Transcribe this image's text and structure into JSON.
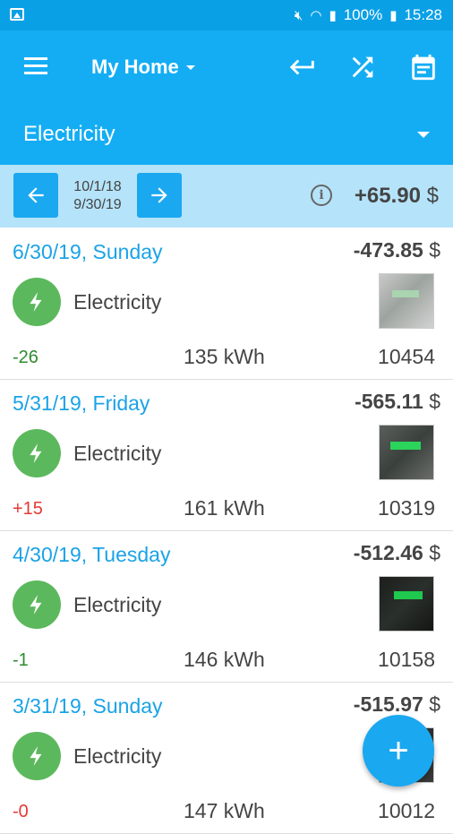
{
  "status_bar": {
    "battery": "100%",
    "time": "15:28"
  },
  "app_bar": {
    "title": "My Home",
    "category": "Electricity"
  },
  "period": {
    "start": "10/1/18",
    "end": "9/30/19",
    "total_amount": "+65.90",
    "currency": "$"
  },
  "entries": [
    {
      "date": "6/30/19, Sunday",
      "amount": "-473.85",
      "currency": "$",
      "category": "Electricity",
      "diff": "-26",
      "usage": "135 kWh",
      "reading": "10454"
    },
    {
      "date": "5/31/19, Friday",
      "amount": "-565.11",
      "currency": "$",
      "category": "Electricity",
      "diff": "+15",
      "usage": "161 kWh",
      "reading": "10319"
    },
    {
      "date": "4/30/19, Tuesday",
      "amount": "-512.46",
      "currency": "$",
      "category": "Electricity",
      "diff": "-1",
      "usage": "146 kWh",
      "reading": "10158"
    },
    {
      "date": "3/31/19, Sunday",
      "amount": "-515.97",
      "currency": "$",
      "category": "Electricity",
      "diff": "-0",
      "usage": "147 kWh",
      "reading": "10012"
    }
  ],
  "fab": {
    "label": "+"
  },
  "colors": {
    "primary": "#14adf4",
    "status_bar": "#0aa0e6",
    "period_bar": "#b5e3f9",
    "category_green": "#5cb85c",
    "date_blue": "#1aa3e6",
    "positive_red": "#e53935",
    "negative_green": "#2e8b2e"
  }
}
